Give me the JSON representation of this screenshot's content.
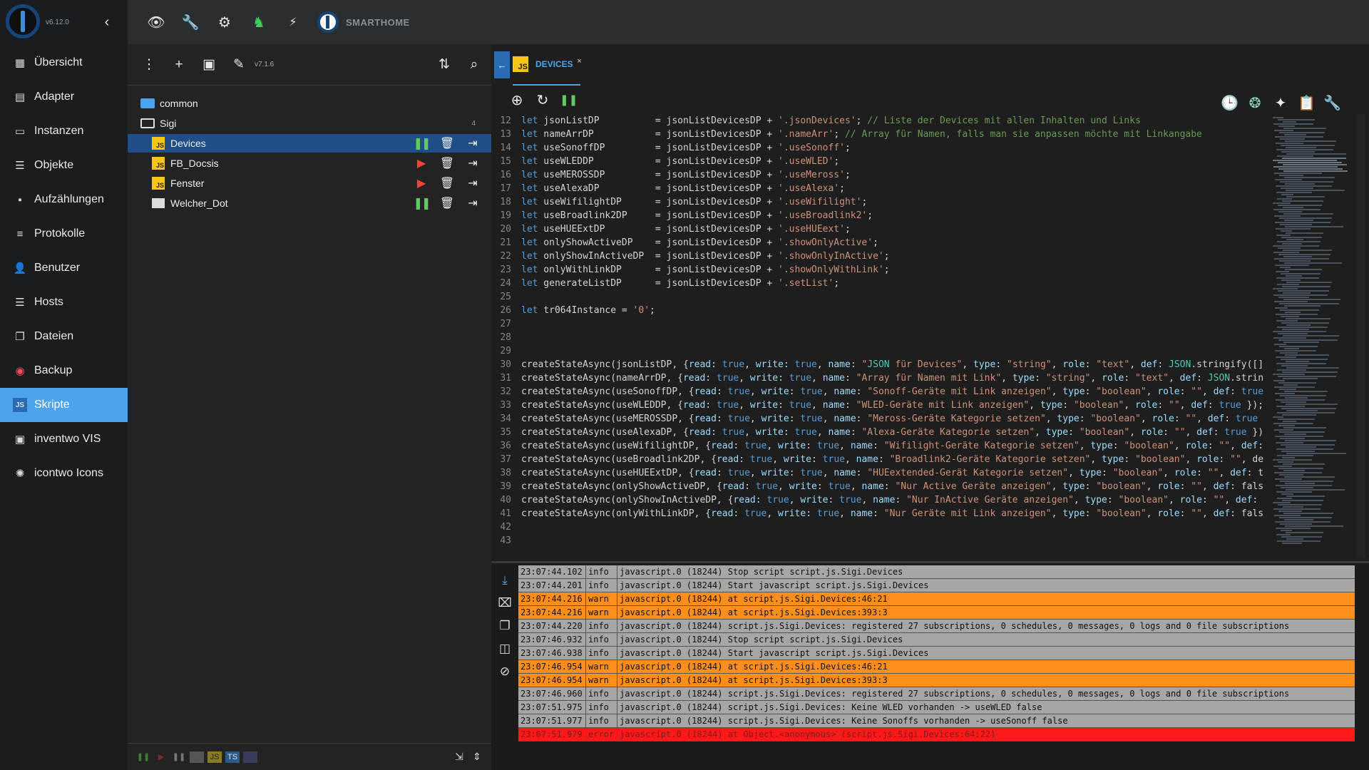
{
  "app": {
    "version": "v6.12.0",
    "brand": "SMARTHOME"
  },
  "nav": [
    {
      "label": "Übersicht",
      "icon": "grid-icon",
      "glyph": "▦"
    },
    {
      "label": "Adapter",
      "icon": "store-icon",
      "glyph": "▤"
    },
    {
      "label": "Instanzen",
      "icon": "instances-icon",
      "glyph": "▭"
    },
    {
      "label": "Objekte",
      "icon": "list-icon",
      "glyph": "☰"
    },
    {
      "label": "Aufzählungen",
      "icon": "enum-icon",
      "glyph": "▪"
    },
    {
      "label": "Protokolle",
      "icon": "log-icon",
      "glyph": "≡"
    },
    {
      "label": "Benutzer",
      "icon": "user-icon",
      "glyph": "👤"
    },
    {
      "label": "Hosts",
      "icon": "hosts-icon",
      "glyph": "☰"
    },
    {
      "label": "Dateien",
      "icon": "files-icon",
      "glyph": "❐"
    },
    {
      "label": "Backup",
      "icon": "backup-icon",
      "glyph": "◉"
    },
    {
      "label": "Skripte",
      "icon": "js-icon",
      "glyph": "JS"
    },
    {
      "label": "inventwo VIS",
      "icon": "vis-icon",
      "glyph": "▣"
    },
    {
      "label": "icontwo Icons",
      "icon": "icons-icon",
      "glyph": "✺"
    }
  ],
  "topbar": {
    "icons": [
      "eye-icon",
      "wrench-icon",
      "gear-icon",
      "adapter-icon",
      "expert-icon"
    ]
  },
  "tree": {
    "version": "v7.1.6",
    "folders": [
      {
        "label": "common"
      },
      {
        "label": "Sigi",
        "count": "4"
      }
    ],
    "scripts": [
      {
        "label": "Devices",
        "state": "running",
        "type": "js"
      },
      {
        "label": "FB_Docsis",
        "state": "stopped",
        "type": "js"
      },
      {
        "label": "Fenster",
        "state": "stopped",
        "type": "js"
      },
      {
        "label": "Welcher_Dot",
        "state": "running",
        "type": "blockly"
      }
    ],
    "bottom": [
      "Blockly",
      "JS",
      "TS",
      "Rules"
    ]
  },
  "editor": {
    "tab": "DEVICES",
    "lines": [
      {
        "n": "12",
        "code": "let jsonListDP          = jsonListDevicesDP + '.jsonDevices'; // Liste der Devices mit allen Inhalten und Links"
      },
      {
        "n": "13",
        "code": "let nameArrDP           = jsonListDevicesDP + '.nameArr'; // Array für Namen, falls man sie anpassen möchte mit Linkangabe"
      },
      {
        "n": "14",
        "code": "let useSonoffDP         = jsonListDevicesDP + '.useSonoff';"
      },
      {
        "n": "15",
        "code": "let useWLEDDP           = jsonListDevicesDP + '.useWLED';"
      },
      {
        "n": "16",
        "code": "let useMEROSSDP         = jsonListDevicesDP + '.useMeross';"
      },
      {
        "n": "17",
        "code": "let useAlexaDP          = jsonListDevicesDP + '.useAlexa';"
      },
      {
        "n": "18",
        "code": "let useWifilightDP      = jsonListDevicesDP + '.useWifilight';"
      },
      {
        "n": "19",
        "code": "let useBroadlink2DP     = jsonListDevicesDP + '.useBroadlink2';"
      },
      {
        "n": "20",
        "code": "let useHUEExtDP         = jsonListDevicesDP + '.useHUEext';"
      },
      {
        "n": "21",
        "code": "let onlyShowActiveDP    = jsonListDevicesDP + '.showOnlyActive';"
      },
      {
        "n": "22",
        "code": "let onlyShowInActiveDP  = jsonListDevicesDP + '.showOnlyInActive';"
      },
      {
        "n": "23",
        "code": "let onlyWithLinkDP      = jsonListDevicesDP + '.showOnlyWithLink';"
      },
      {
        "n": "24",
        "code": "let generateListDP      = jsonListDevicesDP + '.setList';"
      },
      {
        "n": "25",
        "code": ""
      },
      {
        "n": "26",
        "code": "let tr064Instance = '0';"
      },
      {
        "n": "27",
        "code": ""
      },
      {
        "n": "28",
        "code": ""
      },
      {
        "n": "29",
        "code": ""
      },
      {
        "n": "30",
        "code": "createStateAsync(jsonListDP, {read: true, write: true, name: \"JSON für Devices\", type: \"string\", role: \"text\", def: JSON.stringify([]"
      },
      {
        "n": "31",
        "code": "createStateAsync(nameArrDP, {read: true, write: true, name: \"Array für Namen mit Link\", type: \"string\", role: \"text\", def: JSON.strin"
      },
      {
        "n": "32",
        "code": "createStateAsync(useSonoffDP, {read: true, write: true, name: \"Sonoff-Geräte mit Link anzeigen\", type: \"boolean\", role: \"\", def: true"
      },
      {
        "n": "33",
        "code": "createStateAsync(useWLEDDP, {read: true, write: true, name: \"WLED-Geräte mit Link anzeigen\", type: \"boolean\", role: \"\", def: true });"
      },
      {
        "n": "34",
        "code": "createStateAsync(useMEROSSDP, {read: true, write: true, name: \"Meross-Geräte Kategorie setzen\", type: \"boolean\", role: \"\", def: true"
      },
      {
        "n": "35",
        "code": "createStateAsync(useAlexaDP, {read: true, write: true, name: \"Alexa-Geräte Kategorie setzen\", type: \"boolean\", role: \"\", def: true })"
      },
      {
        "n": "36",
        "code": "createStateAsync(useWifilightDP, {read: true, write: true, name: \"Wifilight-Geräte Kategorie setzen\", type: \"boolean\", role: \"\", def:"
      },
      {
        "n": "37",
        "code": "createStateAsync(useBroadlink2DP, {read: true, write: true, name: \"Broadlink2-Geräte Kategorie setzen\", type: \"boolean\", role: \"\", de"
      },
      {
        "n": "38",
        "code": "createStateAsync(useHUEExtDP, {read: true, write: true, name: \"HUEextended-Gerät Kategorie setzen\", type: \"boolean\", role: \"\", def: t"
      },
      {
        "n": "39",
        "code": "createStateAsync(onlyShowActiveDP, {read: true, write: true, name: \"Nur Active Geräte anzeigen\", type: \"boolean\", role: \"\", def: fals"
      },
      {
        "n": "40",
        "code": "createStateAsync(onlyShowInActiveDP, {read: true, write: true, name: \"Nur InActive Geräte anzeigen\", type: \"boolean\", role: \"\", def:"
      },
      {
        "n": "41",
        "code": "createStateAsync(onlyWithLinkDP, {read: true, write: true, name: \"Nur Geräte mit Link anzeigen\", type: \"boolean\", role: \"\", def: fals"
      },
      {
        "n": "42",
        "code": ""
      },
      {
        "n": "43",
        "code": ""
      }
    ]
  },
  "log": [
    {
      "time": "23:07:44.102",
      "sev": "info",
      "msg": "javascript.0 (18244) Stop script script.js.Sigi.Devices"
    },
    {
      "time": "23:07:44.201",
      "sev": "info",
      "msg": "javascript.0 (18244) Start javascript script.js.Sigi.Devices"
    },
    {
      "time": "23:07:44.216",
      "sev": "warn",
      "msg": "javascript.0 (18244) at script.js.Sigi.Devices:46:21"
    },
    {
      "time": "23:07:44.216",
      "sev": "warn",
      "msg": "javascript.0 (18244) at script.js.Sigi.Devices:393:3"
    },
    {
      "time": "23:07:44.220",
      "sev": "info",
      "msg": "javascript.0 (18244) script.js.Sigi.Devices: registered 27 subscriptions, 0 schedules, 0 messages, 0 logs and 0 file subscriptions"
    },
    {
      "time": "23:07:46.932",
      "sev": "info",
      "msg": "javascript.0 (18244) Stop script script.js.Sigi.Devices"
    },
    {
      "time": "23:07:46.938",
      "sev": "info",
      "msg": "javascript.0 (18244) Start javascript script.js.Sigi.Devices"
    },
    {
      "time": "23:07:46.954",
      "sev": "warn",
      "msg": "javascript.0 (18244) at script.js.Sigi.Devices:46:21"
    },
    {
      "time": "23:07:46.954",
      "sev": "warn",
      "msg": "javascript.0 (18244) at script.js.Sigi.Devices:393:3"
    },
    {
      "time": "23:07:46.960",
      "sev": "info",
      "msg": "javascript.0 (18244) script.js.Sigi.Devices: registered 27 subscriptions, 0 schedules, 0 messages, 0 logs and 0 file subscriptions"
    },
    {
      "time": "23:07:51.975",
      "sev": "info",
      "msg": "javascript.0 (18244) script.js.Sigi.Devices: Keine WLED vorhanden -> useWLED false"
    },
    {
      "time": "23:07:51.977",
      "sev": "info",
      "msg": "javascript.0 (18244) script.js.Sigi.Devices: Keine Sonoffs vorhanden -> useSonoff false"
    },
    {
      "time": "23:07:51.979",
      "sev": "error",
      "msg": "javascript.0 (18244) at Object.<anonymous> (script.js.Sigi.Devices:64:22)"
    }
  ],
  "colors": {
    "accent": "#4da3ec",
    "selected": "#1f4f86",
    "warn": "#ff8f1c",
    "error": "#ff1a1a",
    "info": "#a6a6a6"
  }
}
